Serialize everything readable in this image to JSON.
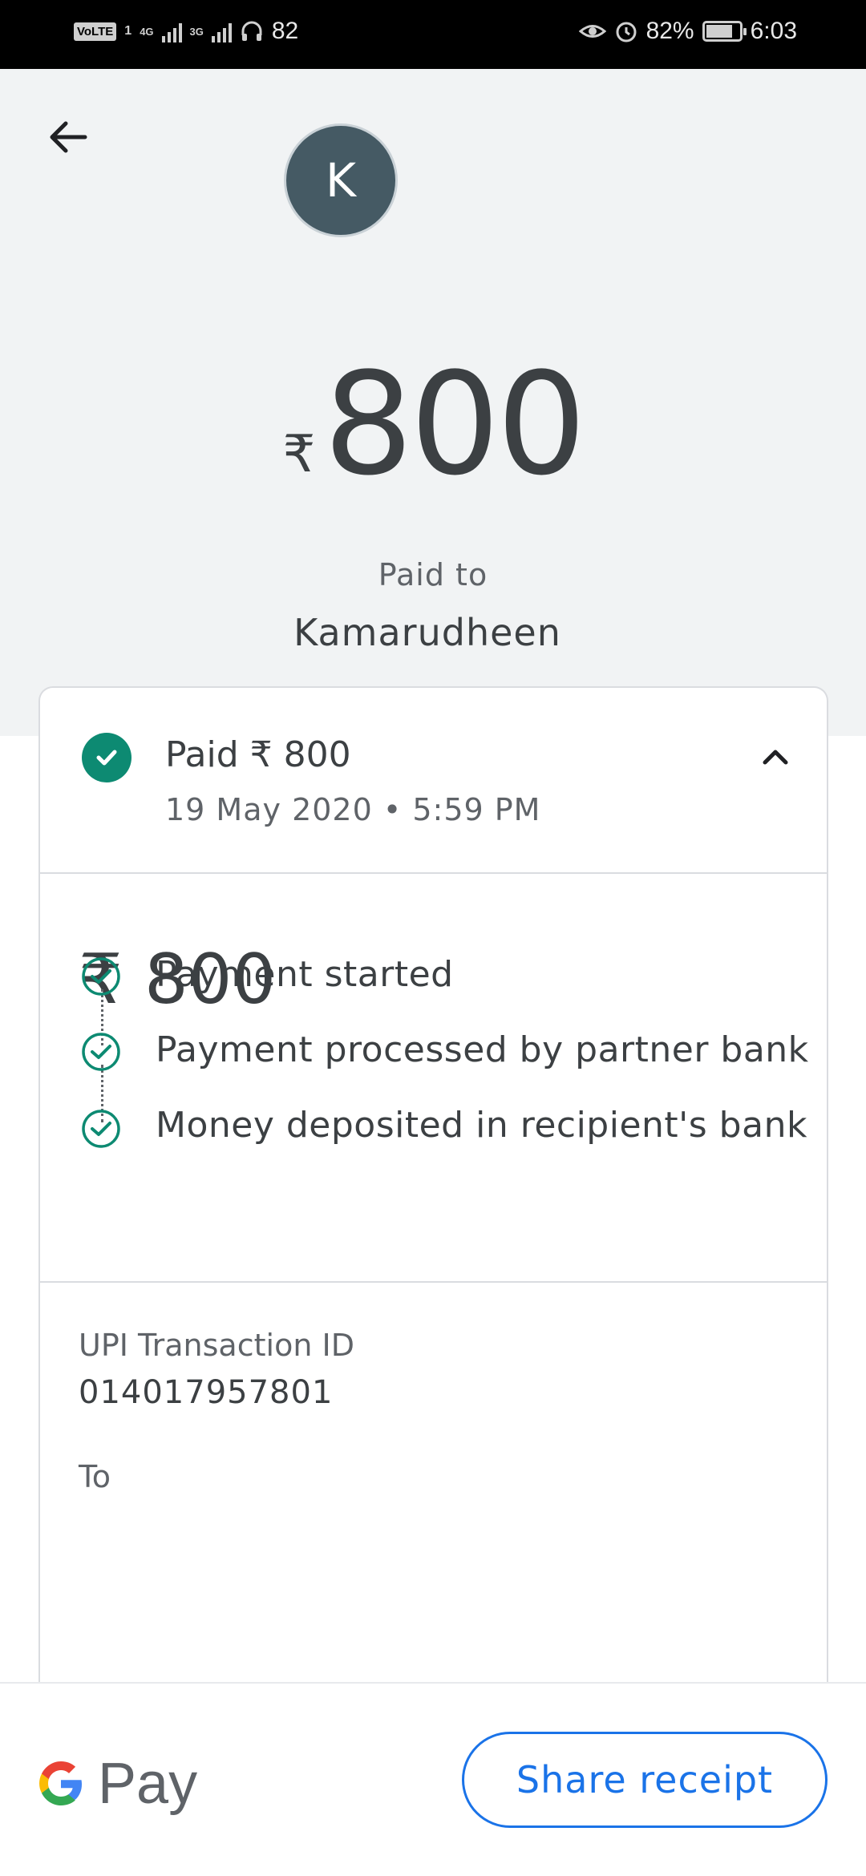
{
  "status_bar": {
    "volte": "VoLTE",
    "sim1_net": "4G",
    "sim2_net": "3G",
    "extra": "82",
    "battery_pct": "82%",
    "battery_level": 0.82,
    "time": "6:03"
  },
  "header": {
    "avatar_initial": "K",
    "currency": "₹",
    "amount": "800",
    "paid_to_label": "Paid to",
    "payee_name": "Kamarudheen"
  },
  "summary": {
    "title": "Paid ₹ 800",
    "datetime": "19 May 2020 • 5:59 PM"
  },
  "detail": {
    "amount": "₹ 800",
    "steps": [
      {
        "label": "Payment started"
      },
      {
        "label": "Payment processed by partner bank"
      },
      {
        "label": "Money deposited in recipient's bank"
      }
    ]
  },
  "transaction": {
    "id_label": "UPI Transaction ID",
    "id_value": "014017957801",
    "to_label": "To"
  },
  "footer": {
    "brand": "Pay",
    "share_label": "Share receipt"
  },
  "colors": {
    "accent": "#1a73e8",
    "success": "#0d8a72",
    "avatar": "#455a64"
  }
}
